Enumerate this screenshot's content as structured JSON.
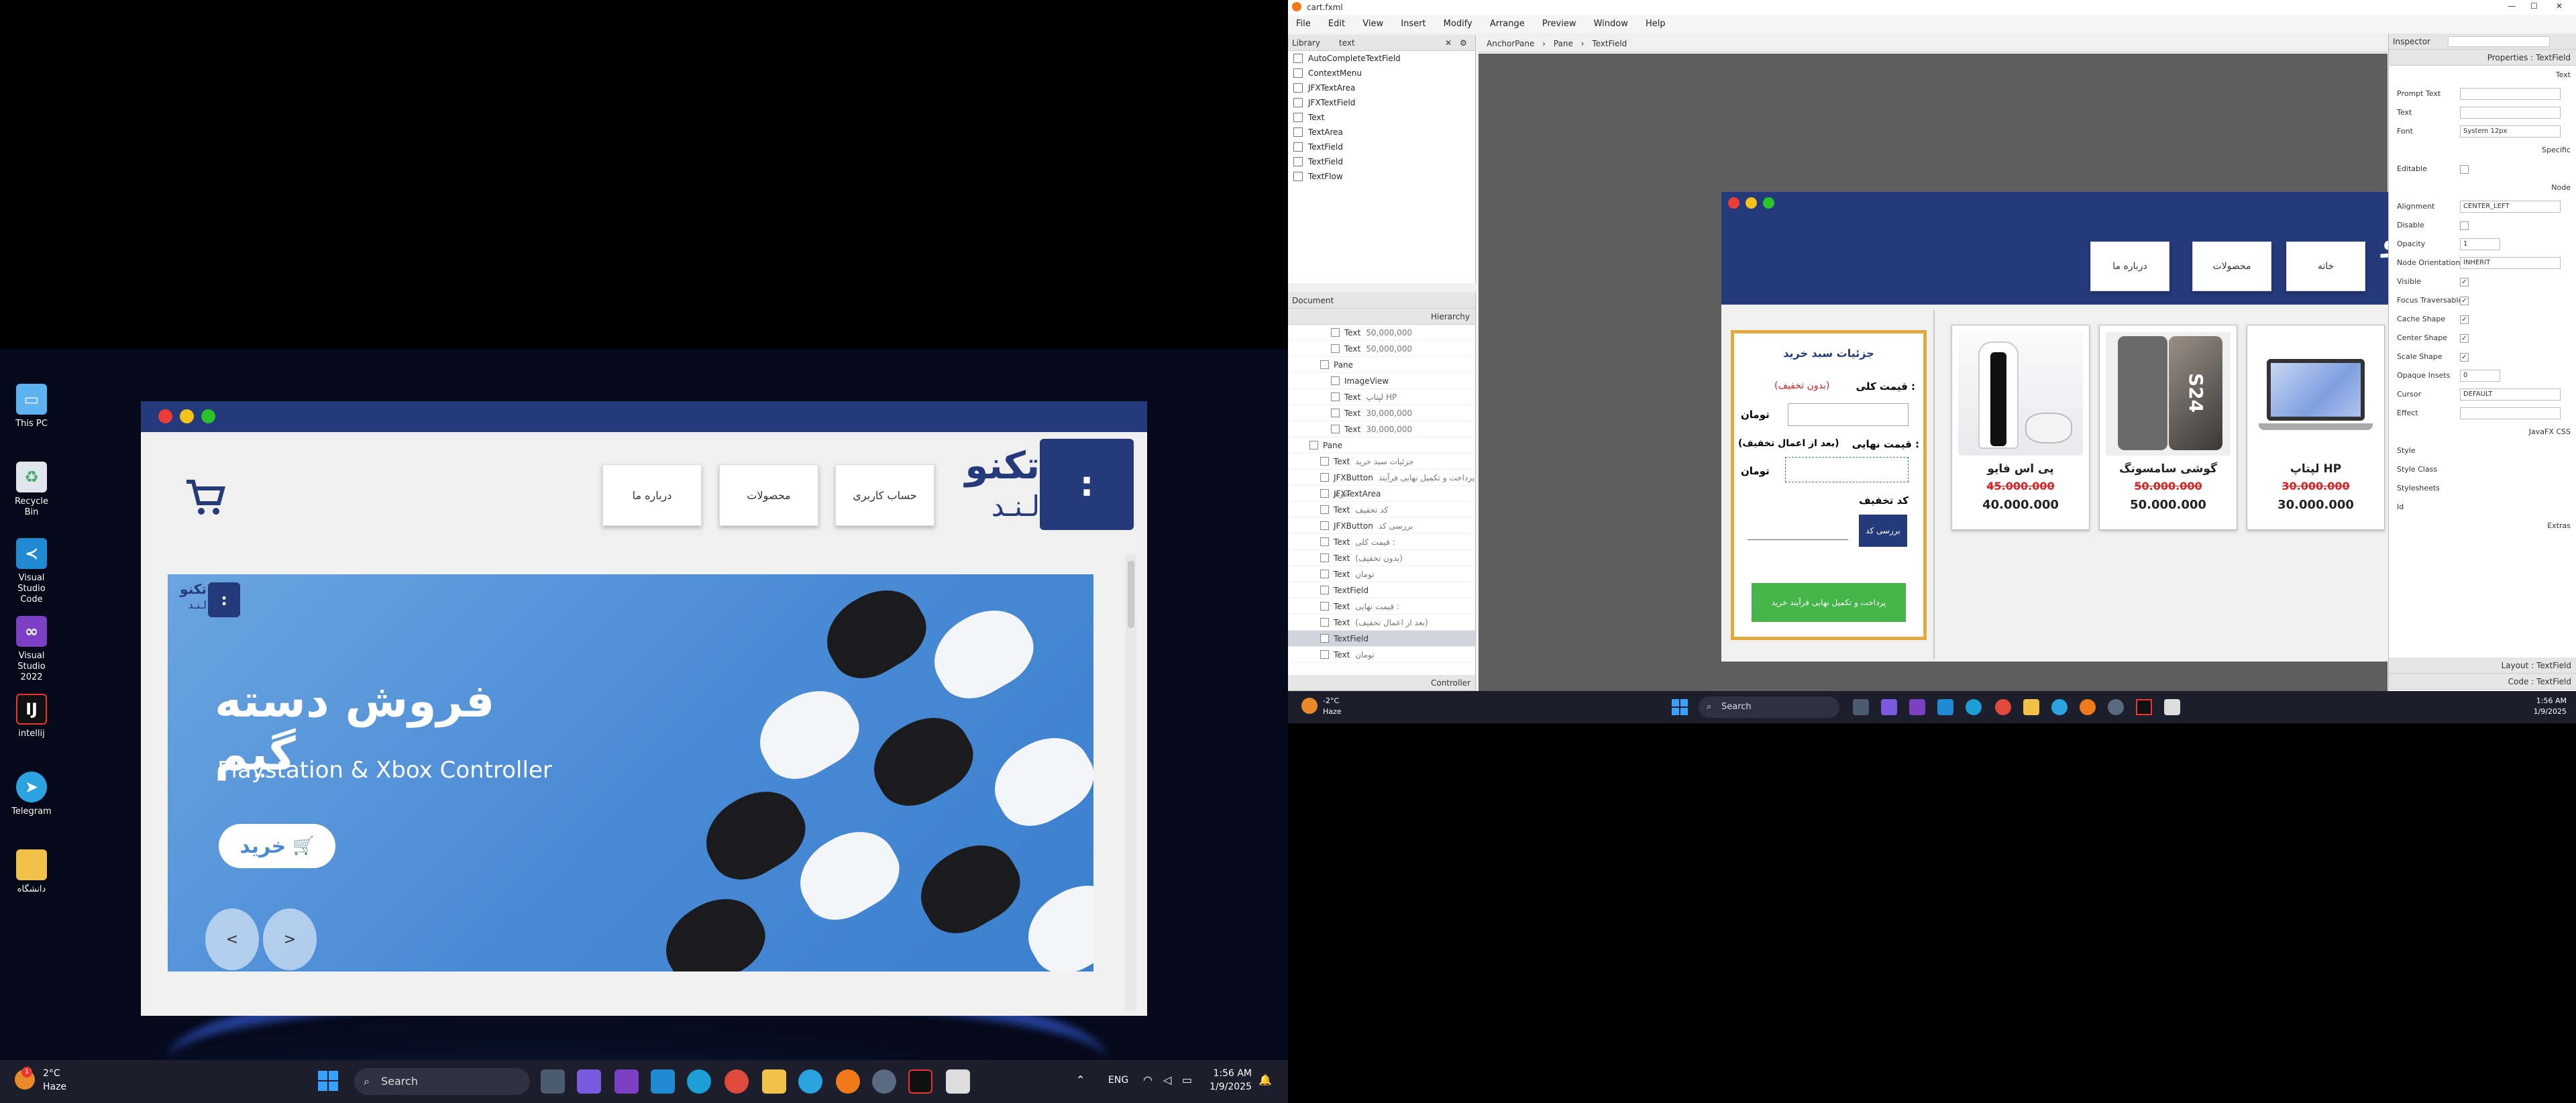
{
  "left_desktop": {
    "icons": [
      {
        "label": "This PC",
        "icon": "monitor-icon"
      },
      {
        "label": "Recycle Bin",
        "icon": "recycle-bin-icon"
      },
      {
        "label": "Visual Studio Code",
        "icon": "vscode-icon"
      },
      {
        "label": "Visual Studio 2022",
        "icon": "visual-studio-icon"
      },
      {
        "label": "intellij",
        "icon": "intellij-icon"
      },
      {
        "label": "Telegram",
        "icon": "telegram-icon"
      },
      {
        "label": "دانشگاه",
        "icon": "folder-icon"
      }
    ]
  },
  "store_app": {
    "logo_main": "تکنو",
    "logo_sub": "لـنـد",
    "nav": [
      "حساب کاربری",
      "محصولات",
      "درباره ما"
    ],
    "banner": {
      "logo_main": "تکنو",
      "logo_sub": "لـنـد",
      "title": "فروش دسته گیم",
      "subtitle": "Playstation & Xbox Controller",
      "buy_label": "خرید",
      "prev": "<",
      "next": ">"
    }
  },
  "taskbar_left": {
    "weather_temp": "2°C",
    "weather_desc": "Haze",
    "search_placeholder": "Search",
    "lang": "ENG",
    "time": "1:56 AM",
    "date": "1/9/2025",
    "badge": "1"
  },
  "scene_builder": {
    "window_title": "cart.fxml",
    "menu": [
      "File",
      "Edit",
      "View",
      "Insert",
      "Modify",
      "Arrange",
      "Preview",
      "Window",
      "Help"
    ],
    "library": {
      "title": "Library",
      "search_value": "text",
      "items": [
        "AutoCompleteTextField",
        "ContextMenu",
        "JFXTextArea",
        "JFXTextField",
        "Text",
        "TextArea",
        "TextField",
        "TextField",
        "TextFlow"
      ]
    },
    "document": {
      "title": "Document",
      "hierarchy_label": "Hierarchy",
      "controller_label": "Controller",
      "rows": [
        {
          "type": "Text",
          "value": "50,000,000",
          "indent": 3
        },
        {
          "type": "Text",
          "value": "50,000,000",
          "indent": 3
        },
        {
          "type": "Pane",
          "value": "",
          "indent": 2
        },
        {
          "type": "ImageView",
          "value": "",
          "indent": 3
        },
        {
          "type": "Text",
          "value": "لپتاپ HP",
          "indent": 3
        },
        {
          "type": "Text",
          "value": "30,000,000",
          "indent": 3
        },
        {
          "type": "Text",
          "value": "30,000,000",
          "indent": 3
        },
        {
          "type": "Pane",
          "value": "",
          "indent": 1
        },
        {
          "type": "Text",
          "value": "جزئیات سبد خرید",
          "indent": 2
        },
        {
          "type": "JFXButton",
          "value": "پرداخت و تکمیل نهایی فرآیند خرید",
          "indent": 2
        },
        {
          "type": "JFXTextArea",
          "value": "",
          "indent": 2
        },
        {
          "type": "Text",
          "value": "کد تخفیف",
          "indent": 2
        },
        {
          "type": "JFXButton",
          "value": "بررسی کد",
          "indent": 2
        },
        {
          "type": "Text",
          "value": "قیمت کلی :",
          "indent": 2
        },
        {
          "type": "Text",
          "value": "(بدون تخفیف)",
          "indent": 2
        },
        {
          "type": "Text",
          "value": "تومان",
          "indent": 2
        },
        {
          "type": "TextField",
          "value": "",
          "indent": 2
        },
        {
          "type": "Text",
          "value": "قیمت نهایی :",
          "indent": 2
        },
        {
          "type": "Text",
          "value": "(بعد از اعمال تخفیف)",
          "indent": 2
        },
        {
          "type": "TextField",
          "value": "",
          "indent": 2,
          "selected": true
        },
        {
          "type": "Text",
          "value": "تومان",
          "indent": 2
        }
      ]
    },
    "breadcrumb": [
      "AnchorPane",
      "Pane",
      "TextField"
    ],
    "preview": {
      "logo_main": "تکنو",
      "logo_sub": "لـنـد",
      "nav": [
        "خانه",
        "محصولات",
        "درباره ما"
      ],
      "products": [
        {
          "title": "پی اس فایو",
          "old_price": "45.000.000",
          "new_price": "40.000.000",
          "img": "ps5-image"
        },
        {
          "title": "گوشی سامسونگ",
          "old_price": "50.000.000",
          "new_price": "50.000.000",
          "img": "samsung-phone-image"
        },
        {
          "title": "لپتاپ HP",
          "old_price": "30.000.000",
          "new_price": "30.000.000",
          "img": "hp-laptop-image"
        }
      ],
      "cart": {
        "title": "جزئیات سبد خرید",
        "total_label": "قیمت کلی :",
        "total_note": "(بدون تخفیف)",
        "currency": "تومان",
        "final_label": "قیمت نهایی :",
        "final_note": "(بعد از اعمال تخفیف)",
        "discount_label": "کد تخفیف",
        "check_button": "بررسی کد",
        "pay_button": "پرداخت و تکمیل نهایی فرآیند خرید"
      }
    },
    "inspector": {
      "title": "Inspector",
      "properties_label": "Properties : TextField",
      "text_section": "Text",
      "fields": [
        {
          "label": "Prompt Text",
          "value": ""
        },
        {
          "label": "Text",
          "value": ""
        },
        {
          "label": "Font",
          "value": "System 12px"
        }
      ],
      "specific_section": "Specific",
      "editable_label": "Editable",
      "node_section": "Node",
      "node_fields": [
        {
          "label": "Alignment",
          "value": "CENTER_LEFT",
          "kind": "select"
        },
        {
          "label": "Disable",
          "value": "",
          "kind": "check"
        },
        {
          "label": "Opacity",
          "value": "1",
          "kind": "text"
        },
        {
          "label": "Node Orientation",
          "value": "INHERIT",
          "kind": "select"
        },
        {
          "label": "Visible",
          "value": "✓",
          "kind": "check"
        },
        {
          "label": "Focus Traversable",
          "value": "✓",
          "kind": "check"
        },
        {
          "label": "Cache Shape",
          "value": "✓",
          "kind": "check"
        },
        {
          "label": "Center Shape",
          "value": "✓",
          "kind": "check"
        },
        {
          "label": "Scale Shape",
          "value": "✓",
          "kind": "check"
        },
        {
          "label": "Opaque Insets",
          "value": "0",
          "kind": "text"
        },
        {
          "label": "Cursor",
          "value": "DEFAULT",
          "kind": "select"
        },
        {
          "label": "Effect",
          "value": "",
          "kind": "select"
        }
      ],
      "javafx_css": "JavaFX CSS",
      "css_fields": [
        "Style",
        "Style Class",
        "Stylesheets",
        "Id"
      ],
      "extras": "Extras",
      "layout_label": "Layout : TextField",
      "code_label": "Code : TextField"
    }
  },
  "taskbar_right": {
    "weather_temp": "-2°C",
    "weather_desc": "Haze",
    "search_placeholder": "Search",
    "time": "1:56 AM",
    "date": "1/9/2025"
  }
}
